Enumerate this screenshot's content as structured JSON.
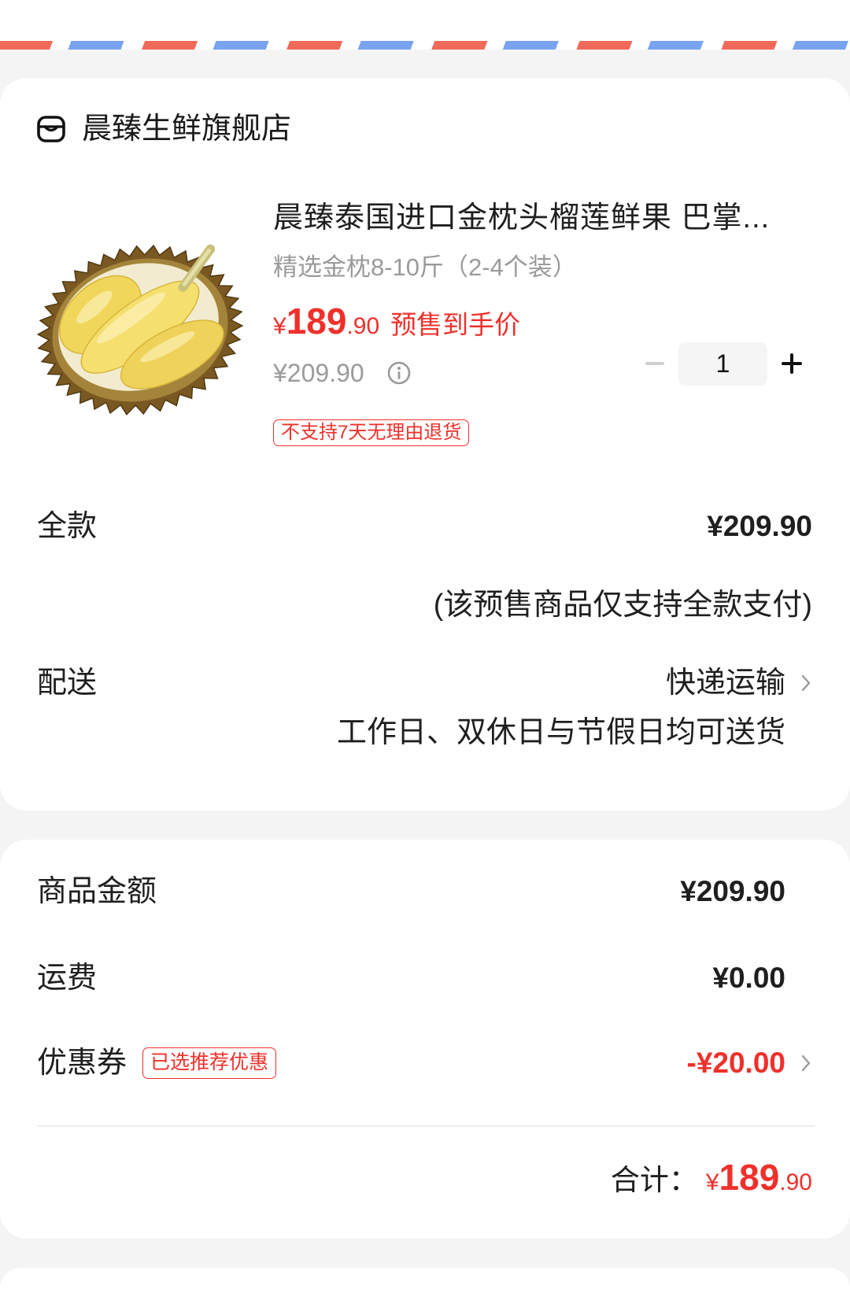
{
  "store": {
    "name": "晨臻生鲜旗舰店"
  },
  "product": {
    "title": "晨臻泰国进口金枕头榴莲鲜果 巴掌...",
    "spec": "精选金枕8-10斤（2-4个装）",
    "price": {
      "symbol": "¥",
      "integer": "189",
      "decimal": ".90",
      "label": "预售到手价"
    },
    "original_price": "¥209.90",
    "quantity": "1",
    "return_tag": "不支持7天无理由退货"
  },
  "payment": {
    "label": "全款",
    "amount": "¥209.90",
    "note": "(该预售商品仅支持全款支付)"
  },
  "delivery": {
    "label": "配送",
    "method": "快递运输",
    "note": "工作日、双休日与节假日均可送货"
  },
  "summary": {
    "goods": {
      "label": "商品金额",
      "value": "¥209.90"
    },
    "shipping": {
      "label": "运费",
      "value": "¥0.00"
    },
    "coupon": {
      "label": "优惠券",
      "tag": "已选推荐优惠",
      "value": "-¥20.00"
    },
    "total": {
      "label": "合计：",
      "symbol": "¥",
      "integer": "189",
      "decimal": ".90"
    }
  },
  "icons": {
    "store": "store-icon",
    "info": "info-icon",
    "minus": "minus-icon",
    "plus": "plus-icon",
    "chevron": "chevron-right-icon",
    "product_image": "durian-image"
  },
  "colors": {
    "accent_red": "#f0302b",
    "text_primary": "#1f1f1f",
    "text_secondary": "#9a9a9a",
    "airmail_red": "#f06a5a",
    "airmail_blue": "#78a3ee",
    "page_background": "#f4f4f4",
    "card_background": "#ffffff"
  }
}
